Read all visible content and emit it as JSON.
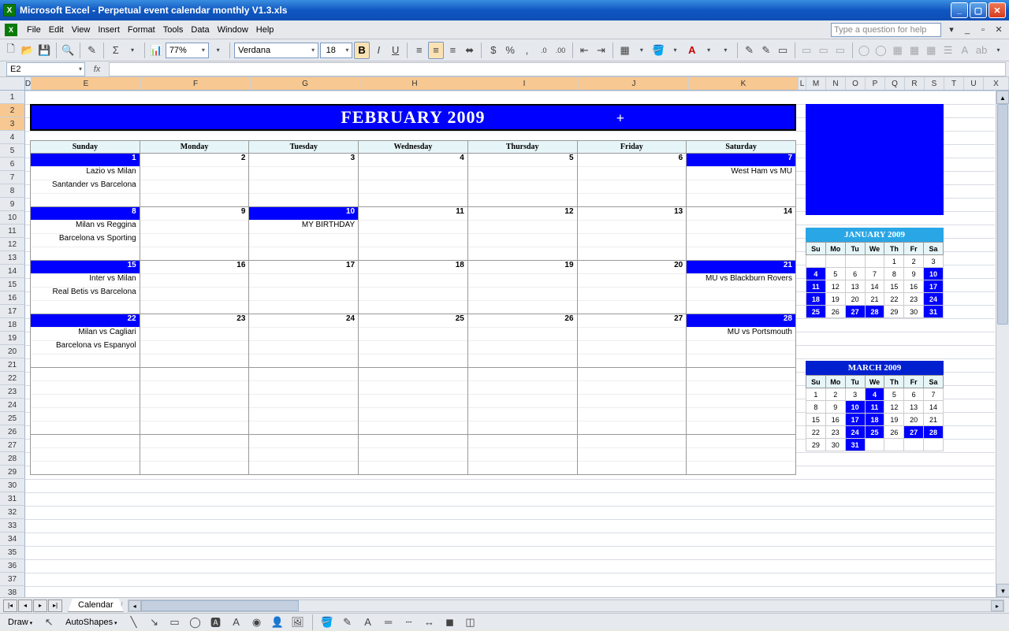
{
  "window": {
    "title": "Microsoft Excel - Perpetual event calendar monthly V1.3.xls"
  },
  "menu": {
    "items": [
      "File",
      "Edit",
      "View",
      "Insert",
      "Format",
      "Tools",
      "Data",
      "Window",
      "Help"
    ],
    "question_placeholder": "Type a question for help"
  },
  "toolbar": {
    "zoom": "77%",
    "font": "Verdana",
    "fontSize": "18"
  },
  "namebox": "E2",
  "columns": {
    "D": 8,
    "E": 139,
    "F": 139,
    "G": 139,
    "H": 139,
    "I": 139,
    "J": 139,
    "K": 139,
    "L": 10,
    "small": [
      "M",
      "N",
      "O",
      "P",
      "Q",
      "R",
      "S",
      "T",
      "U"
    ]
  },
  "rowCount": 38,
  "selectedRows": [
    2,
    3
  ],
  "calendar": {
    "title": "FEBRUARY 2009",
    "days": [
      "Sunday",
      "Monday",
      "Tuesday",
      "Wednesday",
      "Thursday",
      "Friday",
      "Saturday"
    ],
    "weeks": [
      [
        {
          "n": 1,
          "hl": true,
          "ev": [
            "Lazio vs Milan",
            "Santander vs Barcelona"
          ]
        },
        {
          "n": 2,
          "ev": []
        },
        {
          "n": 3,
          "ev": []
        },
        {
          "n": 4,
          "ev": []
        },
        {
          "n": 5,
          "ev": []
        },
        {
          "n": 6,
          "ev": []
        },
        {
          "n": 7,
          "hl": true,
          "ev": [
            "West Ham vs MU"
          ]
        }
      ],
      [
        {
          "n": 8,
          "hl": true,
          "ev": [
            "Milan vs Reggina",
            "Barcelona vs Sporting"
          ]
        },
        {
          "n": 9,
          "ev": []
        },
        {
          "n": 10,
          "hl": true,
          "ev": [
            "MY BIRTHDAY"
          ]
        },
        {
          "n": 11,
          "ev": []
        },
        {
          "n": 12,
          "ev": []
        },
        {
          "n": 13,
          "ev": []
        },
        {
          "n": 14,
          "ev": []
        }
      ],
      [
        {
          "n": 15,
          "hl": true,
          "ev": [
            "Inter vs Milan",
            "Real Betis vs Barcelona"
          ]
        },
        {
          "n": 16,
          "ev": []
        },
        {
          "n": 17,
          "ev": []
        },
        {
          "n": 18,
          "ev": []
        },
        {
          "n": 19,
          "ev": []
        },
        {
          "n": 20,
          "ev": []
        },
        {
          "n": 21,
          "hl": true,
          "ev": [
            "MU vs Blackburn Rovers"
          ]
        }
      ],
      [
        {
          "n": 22,
          "hl": true,
          "ev": [
            "Milan vs Cagliari",
            "Barcelona vs Espanyol"
          ]
        },
        {
          "n": 23,
          "ev": []
        },
        {
          "n": 24,
          "ev": []
        },
        {
          "n": 25,
          "ev": []
        },
        {
          "n": 26,
          "ev": []
        },
        {
          "n": 27,
          "ev": []
        },
        {
          "n": 28,
          "hl": true,
          "ev": [
            "MU vs Portsmouth"
          ]
        }
      ],
      [
        {
          "n": "",
          "ev": []
        },
        {
          "n": "",
          "ev": []
        },
        {
          "n": "",
          "ev": []
        },
        {
          "n": "",
          "ev": []
        },
        {
          "n": "",
          "ev": []
        },
        {
          "n": "",
          "ev": []
        },
        {
          "n": "",
          "ev": []
        }
      ],
      [
        {
          "n": "",
          "ev": []
        },
        {
          "n": "",
          "ev": []
        },
        {
          "n": "",
          "ev": []
        },
        {
          "n": "",
          "ev": []
        },
        {
          "n": "",
          "ev": []
        },
        {
          "n": "",
          "ev": []
        },
        {
          "n": "",
          "ev": []
        }
      ]
    ]
  },
  "mini": {
    "heads": [
      "Su",
      "Mo",
      "Tu",
      "We",
      "Th",
      "Fr",
      "Sa"
    ],
    "jan": {
      "title": "JANUARY 2009",
      "rows": [
        [
          "",
          "",
          "",
          "",
          1,
          2,
          3
        ],
        [
          4,
          5,
          6,
          7,
          8,
          9,
          10
        ],
        [
          11,
          12,
          13,
          14,
          15,
          16,
          17
        ],
        [
          18,
          19,
          20,
          21,
          22,
          23,
          24
        ],
        [
          25,
          26,
          27,
          28,
          29,
          30,
          31
        ]
      ],
      "hl": [
        4,
        10,
        11,
        17,
        18,
        24,
        25,
        27,
        28,
        31
      ]
    },
    "mar": {
      "title": "MARCH 2009",
      "rows": [
        [
          1,
          2,
          3,
          4,
          5,
          6,
          7
        ],
        [
          8,
          9,
          10,
          11,
          12,
          13,
          14
        ],
        [
          15,
          16,
          17,
          18,
          19,
          20,
          21
        ],
        [
          22,
          23,
          24,
          25,
          26,
          27,
          28
        ],
        [
          29,
          30,
          31,
          "",
          "",
          "",
          ""
        ]
      ],
      "hl": [
        4,
        10,
        11,
        17,
        18,
        24,
        25,
        27,
        28,
        31
      ]
    }
  },
  "sheettab": "Calendar",
  "drawbar": {
    "draw": "Draw",
    "autoshapes": "AutoShapes"
  }
}
